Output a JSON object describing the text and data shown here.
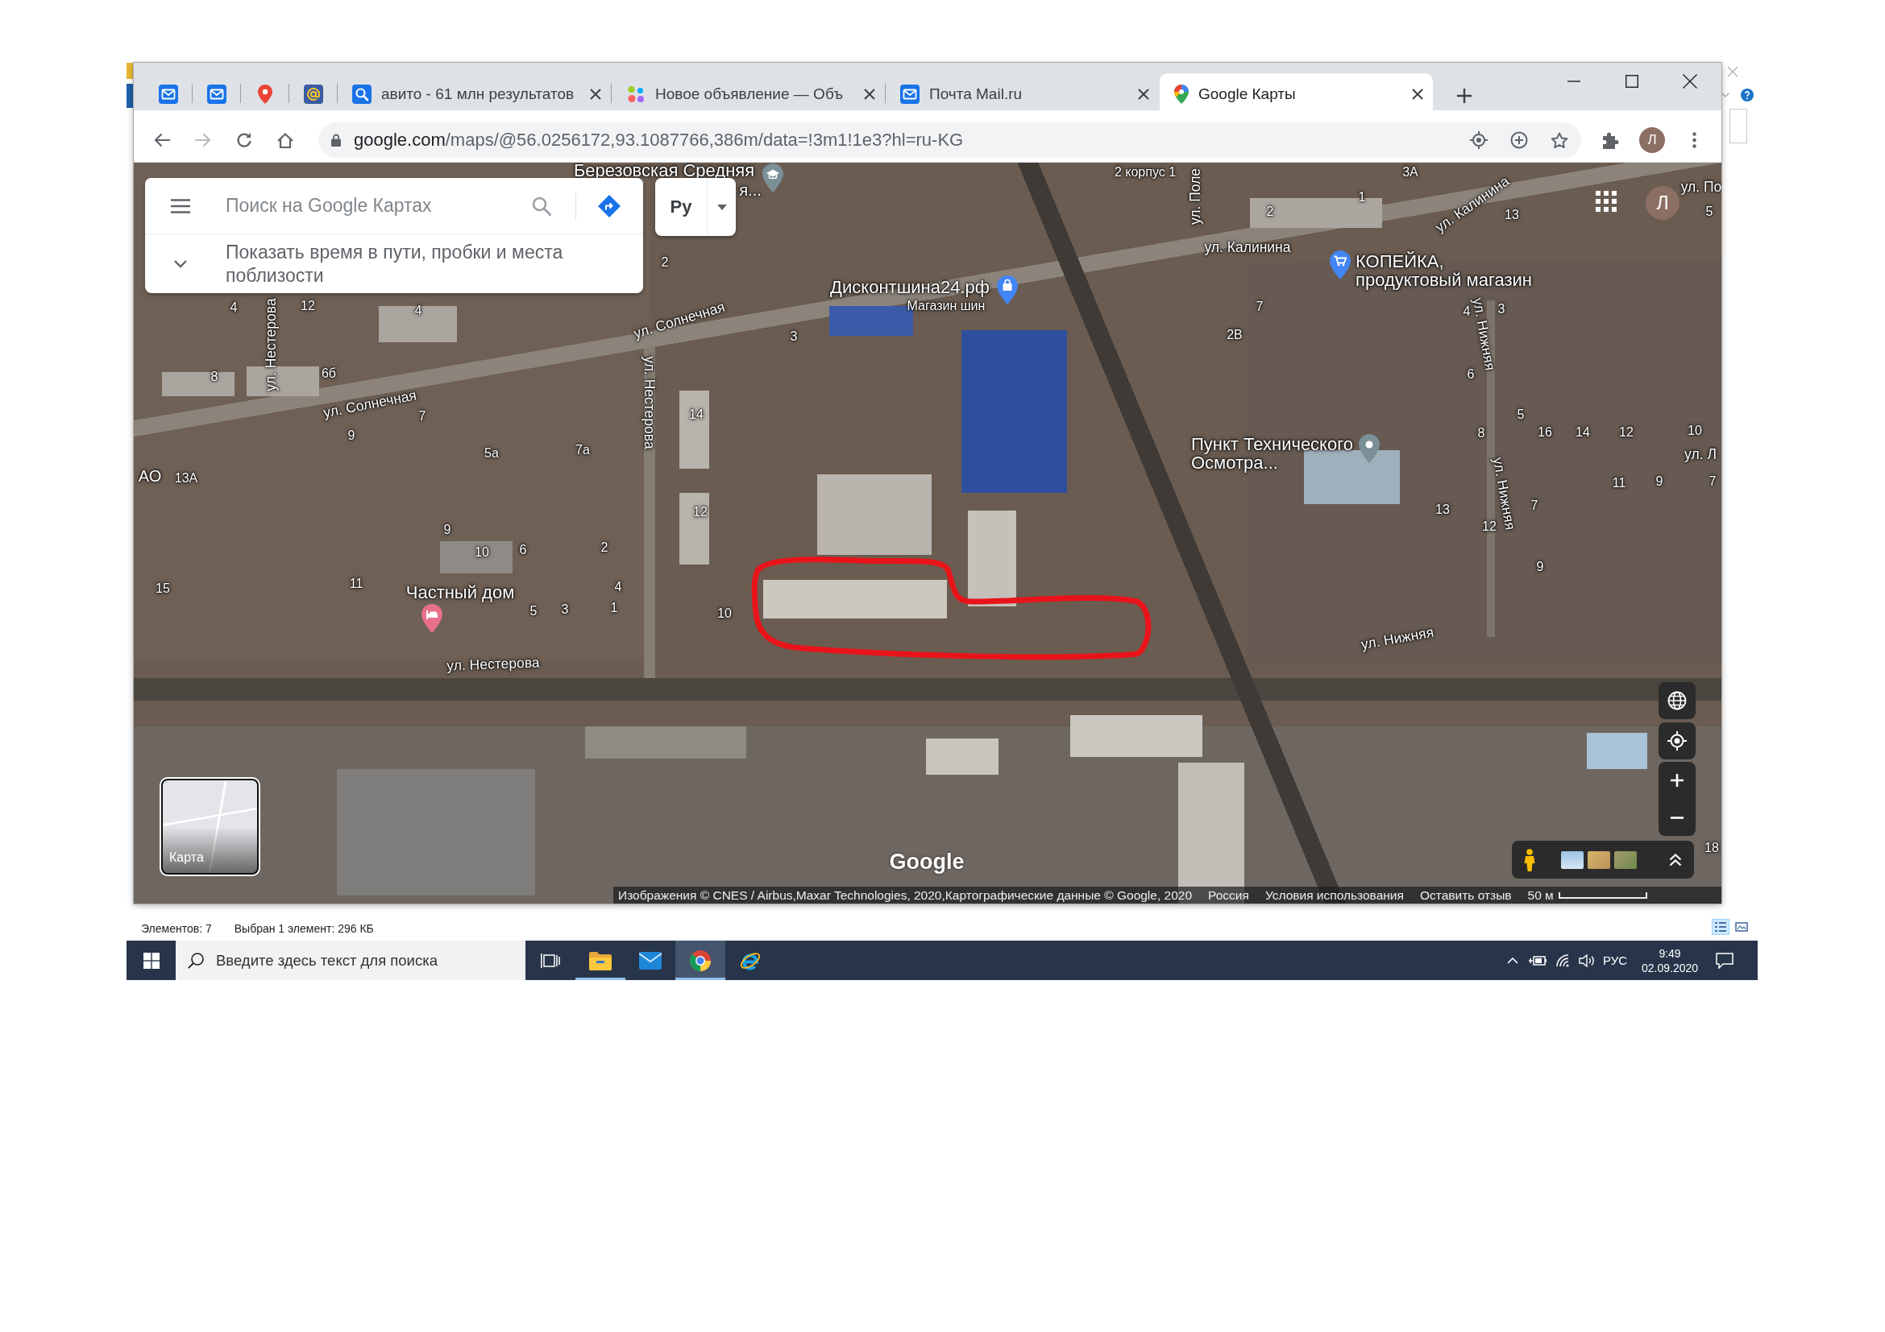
{
  "browser": {
    "tabs": [
      {
        "kind": "pinned",
        "selected": false
      },
      {
        "kind": "pinned",
        "selected": false
      },
      {
        "kind": "pinned",
        "selected": false
      },
      {
        "kind": "pinned",
        "selected": false
      },
      {
        "kind": "tab",
        "title": "авито - 61 млн результатов",
        "selected": false
      },
      {
        "kind": "tab",
        "title": "Новое объявление — Объ",
        "selected": false
      },
      {
        "kind": "tab",
        "title": "Почта Mail.ru",
        "selected": false
      },
      {
        "kind": "tab",
        "title": "Google Карты",
        "selected": true
      }
    ],
    "address": {
      "host": "google.com",
      "path": "/maps/@56.0256172,93.1087766,386m/data=!3m1!1e3?hl=ru-KG"
    },
    "profile_initial": "Л"
  },
  "map": {
    "search": {
      "placeholder": "Поиск на Google Картах"
    },
    "travel_hint": "Показать время в пути, пробки и места поблизости",
    "language_button": "Ру",
    "account_initial": "Л",
    "places": [
      {
        "lines": [
          "Березовская Средняя"
        ],
        "color": "#7b8f97"
      },
      {
        "lines": [
          "Дисконтшина24.рф"
        ],
        "category": "Магазин шин",
        "color": "#4285f4"
      },
      {
        "lines": [
          "КОПЕЙКА,",
          "продуктовый магазин"
        ],
        "color": "#4285f4"
      },
      {
        "lines": [
          "Пункт Технического",
          "Осмотра..."
        ],
        "color": "#7b8f97"
      },
      {
        "lines": [
          "Частный дом"
        ],
        "color": "#e8708a"
      }
    ],
    "label_fragments": [
      "я...",
      "АО"
    ],
    "streets": [
      "ул. Поле",
      "ул. Калинина",
      "ул. По",
      "ул. Калинина",
      "ул. Нестерова",
      "ул. Солнечная",
      "ул. Нижняя",
      "ул. Солнечная",
      "ул. Нестерова",
      "ул. Нижняя",
      "ул. Л",
      "ул. Нижняя",
      "ул. Нестерова"
    ],
    "house_numbers": [
      "2 корпус 1",
      "3А",
      "1",
      "2",
      "13",
      "5",
      "2",
      "4",
      "12",
      "4",
      "7",
      "4",
      "3",
      "3",
      "2В",
      "8",
      "6б",
      "6",
      "7",
      "14",
      "5",
      "9",
      "8",
      "16",
      "14",
      "12",
      "10",
      "5а",
      "7а",
      "13А",
      "11",
      "9",
      "7",
      "12",
      "13",
      "7",
      "9",
      "12",
      "10",
      "6",
      "2",
      "9",
      "15",
      "11",
      "4",
      "5",
      "3",
      "1",
      "10",
      "18"
    ],
    "minimap_label": "Карта",
    "logo": "Google",
    "attribution": {
      "imagery": "Изображения © CNES / Airbus,Maxar Technologies, 2020,Картографические данные © Google, 2020",
      "region": "Россия",
      "terms": "Условия использования",
      "feedback": "Оставить отзыв",
      "scale": "50 м"
    }
  },
  "explorer_status": {
    "items": "Элементов: 7",
    "selection": "Выбран 1 элемент: 296 КБ",
    "views": [
      {
        "selected": true
      },
      {
        "selected": false
      }
    ]
  },
  "taskbar": {
    "search": {
      "placeholder": "Введите здесь текст для поиска"
    },
    "apps": [
      {
        "running": true,
        "selected": false
      },
      {
        "running": false,
        "selected": false
      },
      {
        "running": true,
        "selected": true
      },
      {
        "running": false,
        "selected": false
      }
    ],
    "language": "РУС",
    "time": "9:49",
    "date": "02.09.2020"
  }
}
